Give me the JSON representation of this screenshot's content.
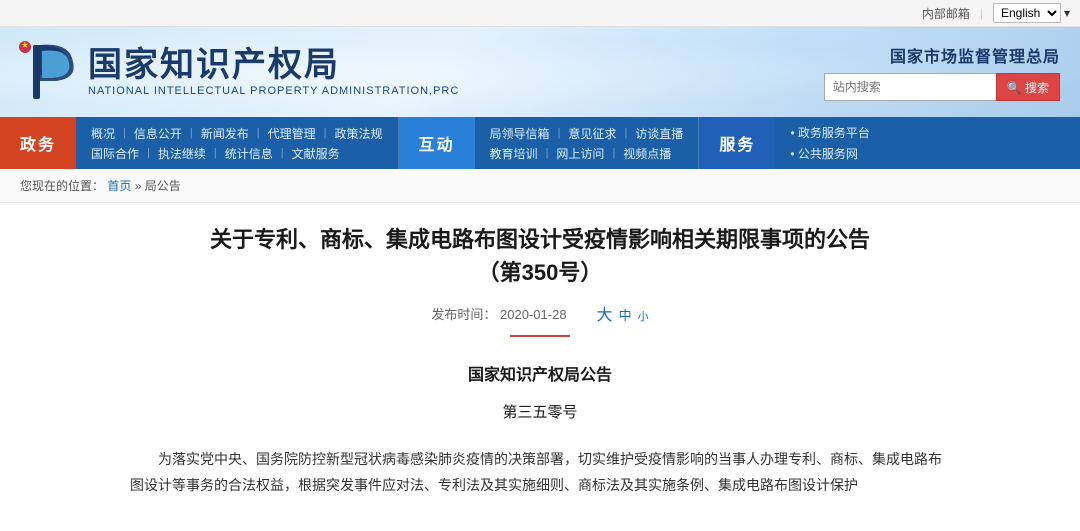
{
  "topbar": {
    "internal_mail": "内部邮箱",
    "lang_label": "English",
    "divider": "|"
  },
  "header": {
    "logo_cn": "国家知识产权局",
    "logo_en": "NATIONAL INTELLECTUAL PROPERTY ADMINISTRATION,PRC",
    "org_name": "国家市场监督管理总局",
    "search_placeholder": "站内搜索",
    "search_btn": "🔍 搜索"
  },
  "nav": {
    "tab_zhengwu": "政务",
    "tab_hudo": "互动",
    "tab_fuwu": "服务",
    "zhengwu_links_row1": [
      "概况",
      "信息公开",
      "新闻发布",
      "代理管理",
      "政策法规"
    ],
    "zhengwu_links_row2": [
      "国际合作",
      "执法继续",
      "统计信息",
      "文献服务"
    ],
    "hudo_links_row1": [
      "局领导信箱",
      "意见征求",
      "访谈直播"
    ],
    "hudo_links_row2": [
      "教育培训",
      "网上访问",
      "视频点播"
    ],
    "fuwu_links": [
      "政务服务平台",
      "公共服务网"
    ]
  },
  "breadcrumb": {
    "you_zai": "您现在的位置：",
    "home": "首页",
    "sep1": "»",
    "current": "局公告"
  },
  "article": {
    "title_line1": "关于专利、商标、集成电路布图设计受疫情影响相关期限事项的公告",
    "title_line2": "（第350号）",
    "publish_label": "发布时间：",
    "publish_date": "2020-01-28",
    "font_large": "大",
    "font_medium": "中",
    "font_small": "小",
    "org_title": "国家知识产权局公告",
    "issue_no": "第三五零号",
    "para1": "为落实党中央、国务院防控新型冠状病毒感染肺炎疫情的决策部署，切实维护受疫情影响的当事人办理专利、商标、集成电路布图设计等事务的合法权益，根据突发事件应对法、专利法及其实施细则、商标法及其实施条例、集成电路布图设计保护"
  }
}
